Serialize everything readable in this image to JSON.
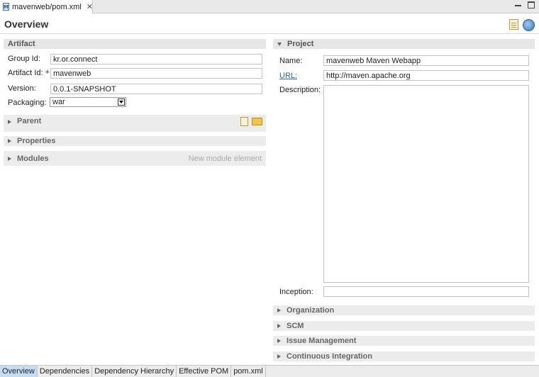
{
  "editor": {
    "file_tab": "mavenweb/pom.xml",
    "file_icon_letter": "M",
    "close_glyph": "✕",
    "title": "Overview"
  },
  "artifact": {
    "section_title": "Artifact",
    "group_id_label": "Group Id:",
    "group_id": "kr.or.connect",
    "artifact_id_label": "Artifact Id:",
    "required_marker": "*",
    "artifact_id": "mavenweb",
    "version_label": "Version:",
    "version": "0.0.1-SNAPSHOT",
    "packaging_label": "Packaging:",
    "packaging": "war"
  },
  "left_sections": {
    "parent": "Parent",
    "properties": "Properties",
    "modules": "Modules",
    "modules_hint": "New module element"
  },
  "project": {
    "section_title": "Project",
    "name_label": "Name:",
    "name": "mavenweb Maven Webapp",
    "url_label": "URL:",
    "url": "http://maven.apache.org",
    "description_label": "Description:",
    "description": "",
    "inception_label": "Inception:",
    "inception": ""
  },
  "right_sections": {
    "organization": "Organization",
    "scm": "SCM",
    "issue_management": "Issue Management",
    "continuous_integration": "Continuous Integration"
  },
  "bottom_tabs": {
    "overview": "Overview",
    "dependencies": "Dependencies",
    "dependency_hierarchy": "Dependency Hierarchy",
    "effective_pom": "Effective POM",
    "pom_xml": "pom.xml"
  },
  "colors": {
    "active_tab": "#c7dcf3",
    "link": "#2a5db0",
    "section_bar": "#e6e6e6"
  }
}
